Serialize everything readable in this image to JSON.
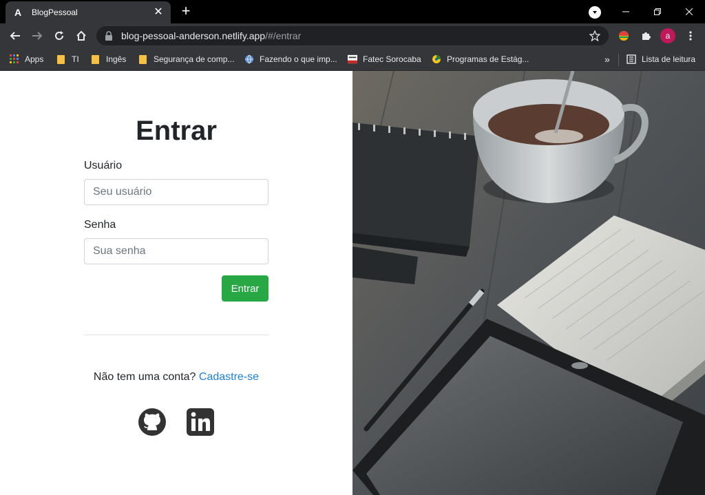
{
  "browser": {
    "tab": {
      "title": "BlogPessoal",
      "favicon": "A"
    },
    "url": {
      "host": "blog-pessoal-anderson.netlify.app",
      "path": "/#/entrar"
    },
    "profile_initial": "a",
    "bookmarks": [
      {
        "label": "Apps",
        "icon": "apps-grid-icon"
      },
      {
        "label": "TI",
        "icon": "folder-icon"
      },
      {
        "label": "Ingês",
        "icon": "folder-icon"
      },
      {
        "label": "Segurança de comp...",
        "icon": "folder-icon"
      },
      {
        "label": "Fazendo o que imp...",
        "icon": "globe-icon"
      },
      {
        "label": "Fatec Sorocaba",
        "icon": "fatec-icon"
      },
      {
        "label": "Programas de Estág...",
        "icon": "site-icon"
      }
    ],
    "reading_list": "Lista de leitura"
  },
  "login": {
    "title": "Entrar",
    "username_label": "Usuário",
    "username_placeholder": "Seu usuário",
    "password_label": "Senha",
    "password_placeholder": "Sua senha",
    "submit_label": "Entrar",
    "signup_prompt": "Não tem uma conta?",
    "signup_link": "Cadastre-se"
  },
  "social": [
    {
      "name": "github",
      "icon": "github-icon"
    },
    {
      "name": "linkedin",
      "icon": "linkedin-icon"
    }
  ],
  "colors": {
    "primary_button": "#28a745",
    "link": "#1e7fd6",
    "browser_chrome": "#35363a"
  }
}
